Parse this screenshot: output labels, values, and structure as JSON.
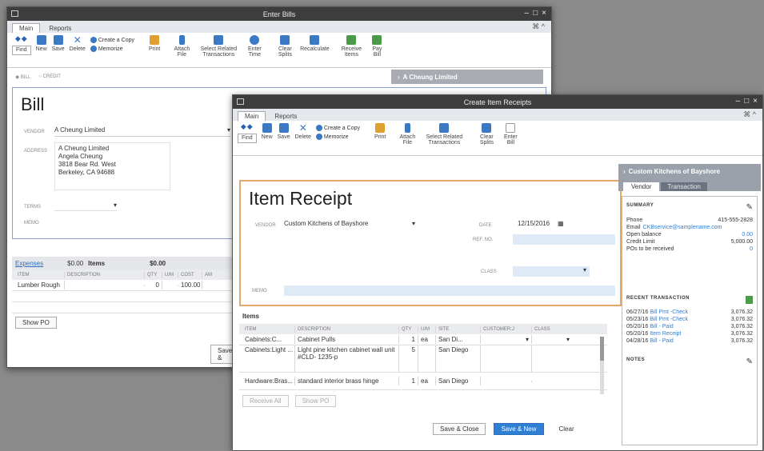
{
  "bills_window": {
    "title": "Enter Bills",
    "tabs": [
      "Main",
      "Reports"
    ],
    "toolbar": {
      "find": "Find",
      "new": "New",
      "save": "Save",
      "delete": "Delete",
      "create_copy": "Create a Copy",
      "memorize": "Memorize",
      "print": "Print",
      "attach": "Attach File",
      "select_related": "Select Related Transactions",
      "enter_time": "Enter Time",
      "clear_splits": "Clear Splits",
      "recalculate": "Recalculate",
      "receive_items": "Receive Items",
      "pay_bill": "Pay Bill"
    },
    "radio_bill": "BILL",
    "radio_credit": "CREDIT",
    "vendor_banner": "A Cheung Limited",
    "heading": "Bill",
    "vendor_label": "VENDOR",
    "vendor_value": "A Cheung Limited",
    "address_label": "ADDRESS",
    "address_lines": [
      "A Cheung Limited",
      "Angela Cheung",
      "3818 Bear Rd. West",
      "Berkeley, CA 94688"
    ],
    "terms_label": "TERMS",
    "memo_label": "MEMO",
    "expenses_tab": "Expenses",
    "expenses_amt": "$0.00",
    "items_tab": "Items",
    "items_amt": "$0.00",
    "cols": [
      "ITEM",
      "DESCRIPTION",
      "QTY",
      "U/M",
      "COST",
      "AM"
    ],
    "row": {
      "item": "Lumber Rough",
      "qty": "0",
      "cost": "100.00"
    },
    "show_po": "Show PO",
    "save_close": "Save &"
  },
  "receipt_window": {
    "title": "Create Item Receipts",
    "tabs": [
      "Main",
      "Reports"
    ],
    "toolbar": {
      "find": "Find",
      "new": "New",
      "save": "Save",
      "delete": "Delete",
      "create_copy": "Create a Copy",
      "memorize": "Memorize",
      "print": "Print",
      "attach": "Attach File",
      "select_related": "Select Related Transactions",
      "clear_splits": "Clear Splits",
      "enter_bill": "Enter Bill"
    },
    "heading": "Item Receipt",
    "vendor_label": "VENDOR",
    "vendor_value": "Custom Kitchens of Bayshore",
    "date_label": "DATE",
    "date_value": "12/15/2016",
    "ref_label": "REF. NO.",
    "class_label": "CLASS",
    "memo_label": "MEMO",
    "items_label": "Items",
    "cols": [
      "ITEM",
      "DESCRIPTION",
      "QTY",
      "U/M",
      "SITE",
      "CUSTOMER:J",
      "CLASS"
    ],
    "rows": [
      {
        "item": "Cabinets:C...",
        "desc": "Cabinet Pulls",
        "qty": "1",
        "um": "ea",
        "site": "San Di..."
      },
      {
        "item": "Cabinets:Light ...",
        "desc": "Light pine kitchen cabinet wall unit",
        "desc2": "#CLD- 1235-p",
        "qty": "5",
        "um": "",
        "site": "San Diego"
      },
      {
        "item": "Hardware:Bras...",
        "desc": "standard interior brass hinge",
        "qty": "1",
        "um": "ea",
        "site": "San Diego"
      }
    ],
    "receive_all": "Receive All",
    "show_po": "Show PO",
    "save_close": "Save & Close",
    "save_new": "Save & New",
    "clear": "Clear"
  },
  "side_panel": {
    "vendor_name": "Custom Kitchens of Bayshore",
    "tab_vendor": "Vendor",
    "tab_transaction": "Transaction",
    "summary_title": "SUMMARY",
    "phone_label": "Phone",
    "phone_value": "415-555-2828",
    "email_label": "Email",
    "email_value": "CKBservice@samplename.com",
    "open_balance_label": "Open balance",
    "open_balance_value": "0.00",
    "credit_limit_label": "Credit Limit",
    "credit_limit_value": "5,000.00",
    "pos_label": "POs to be received",
    "pos_value": "0",
    "recent_title": "RECENT TRANSACTION",
    "transactions": [
      {
        "date": "06/27/16",
        "type": "Bill Pmt -Check",
        "amount": "3,076.32"
      },
      {
        "date": "05/23/16",
        "type": "Bill Pmt -Check",
        "amount": "3,076.32"
      },
      {
        "date": "05/20/16",
        "type": "Bill - Paid",
        "amount": "3,076.32"
      },
      {
        "date": "05/20/16",
        "type": "Item Receipt",
        "amount": "3,076.32"
      },
      {
        "date": "04/28/16",
        "type": "Bill - Paid",
        "amount": "3,076.32"
      }
    ],
    "notes_title": "NOTES"
  },
  "colors": {
    "accent": "#2f7fd4",
    "titlebar": "#3d3d3d",
    "panel_header": "#6b7280",
    "active_orange": "#e5a66a"
  }
}
